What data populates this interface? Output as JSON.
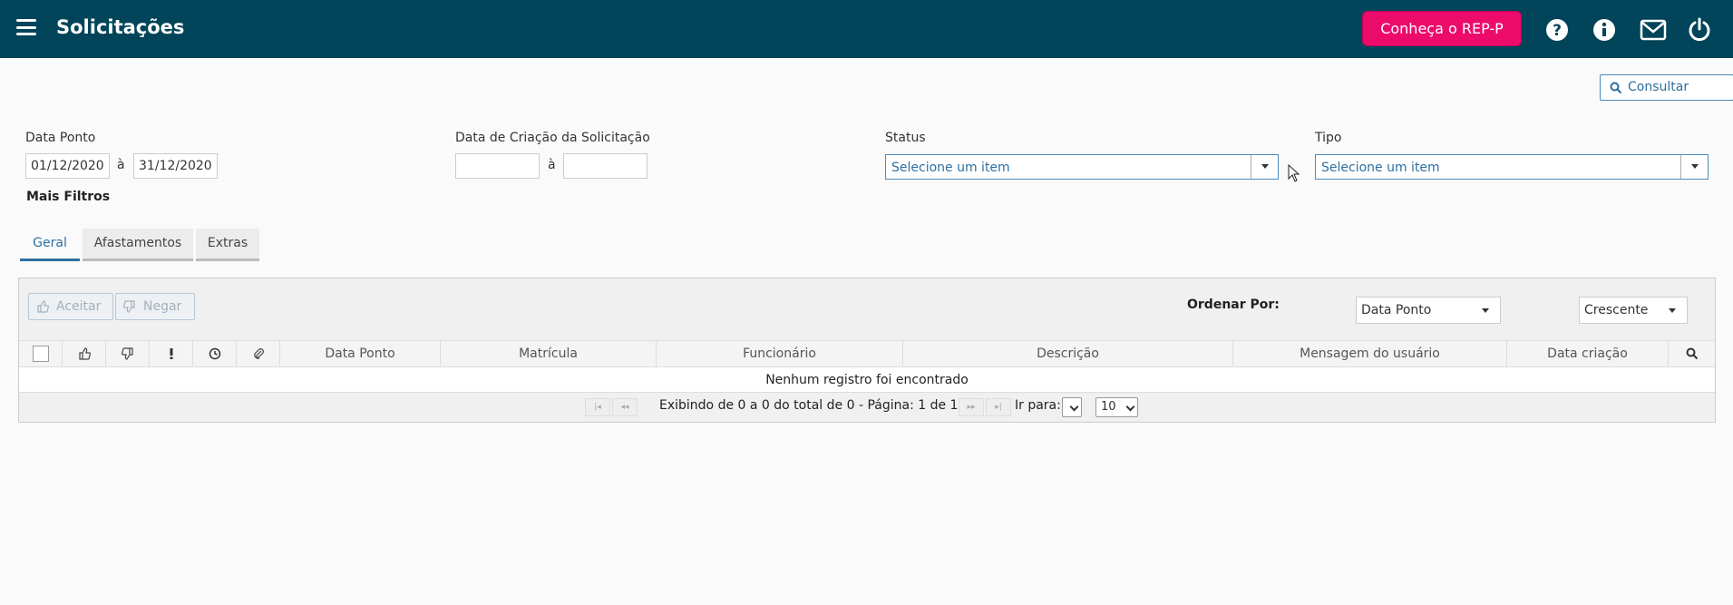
{
  "header": {
    "title": "Solicitações",
    "rep_button": "Conheça o REP-P",
    "icons": [
      "help-icon",
      "info-icon",
      "mail-icon",
      "power-icon"
    ],
    "bg_color": "#024459",
    "accent_color": "#ec0a6a"
  },
  "toolbar": {
    "consultar_label": "Consultar"
  },
  "filters": {
    "data_ponto": {
      "label": "Data Ponto",
      "from": "01/12/2020",
      "to": "31/12/2020",
      "separator": "à"
    },
    "data_criacao": {
      "label": "Data de Criação da Solicitação",
      "from": "",
      "to": "",
      "separator": "à"
    },
    "status": {
      "label": "Status",
      "placeholder": "Selecione um item"
    },
    "tipo": {
      "label": "Tipo",
      "placeholder": "Selecione um item"
    },
    "mais_filtros": "Mais Filtros"
  },
  "tabs": [
    {
      "label": "Geral",
      "active": true
    },
    {
      "label": "Afastamentos",
      "active": false
    },
    {
      "label": "Extras",
      "active": false
    }
  ],
  "grid": {
    "aceitar_label": "Aceitar",
    "negar_label": "Negar",
    "order_label": "Ordenar Por:",
    "order_field": "Data Ponto",
    "order_direction": "Crescente",
    "columns": [
      "Data Ponto",
      "Matrícula",
      "Funcionário",
      "Descrição",
      "Mensagem do usuário",
      "Data criação"
    ],
    "empty_message": "Nenhum registro foi encontrado",
    "pager_info": "Exibindo de 0 a 0 do total de 0 - Página: 1 de 1",
    "goto_label": "Ir para:",
    "page_size": "10"
  }
}
